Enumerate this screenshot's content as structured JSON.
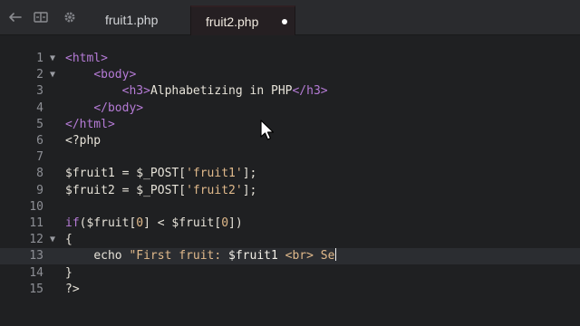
{
  "tabs": [
    {
      "label": "fruit1.php",
      "active": false
    },
    {
      "label": "fruit2.php",
      "active": true,
      "modified": true
    }
  ],
  "toolbar_icons": [
    "back-arrow-icon",
    "split-view-icon",
    "gear-icon"
  ],
  "editor": {
    "current_line": 13,
    "lines": [
      {
        "num": "1",
        "fold": "▼",
        "indent": "",
        "tokens": [
          {
            "t": "<html>",
            "c": "tag"
          }
        ]
      },
      {
        "num": "2",
        "fold": "▼",
        "indent": "    ",
        "tokens": [
          {
            "t": "<body>",
            "c": "tag"
          }
        ]
      },
      {
        "num": "3",
        "fold": "",
        "indent": "        ",
        "tokens": [
          {
            "t": "<h3>",
            "c": "tag"
          },
          {
            "t": "Alphabetizing in PHP",
            "c": "text"
          },
          {
            "t": "</h3>",
            "c": "tag"
          }
        ]
      },
      {
        "num": "4",
        "fold": "",
        "indent": "    ",
        "tokens": [
          {
            "t": "</body>",
            "c": "tag"
          }
        ]
      },
      {
        "num": "5",
        "fold": "",
        "indent": "",
        "tokens": [
          {
            "t": "</html>",
            "c": "tag"
          }
        ]
      },
      {
        "num": "6",
        "fold": "",
        "indent": "",
        "tokens": [
          {
            "t": "<?php",
            "c": "text"
          }
        ]
      },
      {
        "num": "7",
        "fold": "",
        "indent": "",
        "tokens": []
      },
      {
        "num": "8",
        "fold": "",
        "indent": "",
        "tokens": [
          {
            "t": "$fruit1 = $_POST[",
            "c": "text"
          },
          {
            "t": "'fruit1'",
            "c": "str"
          },
          {
            "t": "];",
            "c": "text"
          }
        ]
      },
      {
        "num": "9",
        "fold": "",
        "indent": "",
        "tokens": [
          {
            "t": "$fruit2 = $_POST[",
            "c": "text"
          },
          {
            "t": "'fruit2'",
            "c": "str"
          },
          {
            "t": "];",
            "c": "text"
          }
        ]
      },
      {
        "num": "10",
        "fold": "",
        "indent": "",
        "tokens": []
      },
      {
        "num": "11",
        "fold": "",
        "indent": "",
        "tokens": [
          {
            "t": "if",
            "c": "kw"
          },
          {
            "t": "($fruit[",
            "c": "text"
          },
          {
            "t": "0",
            "c": "str"
          },
          {
            "t": "] < $fruit[",
            "c": "text"
          },
          {
            "t": "0",
            "c": "str"
          },
          {
            "t": "])",
            "c": "text"
          }
        ]
      },
      {
        "num": "12",
        "fold": "▼",
        "indent": "",
        "tokens": [
          {
            "t": "{",
            "c": "text"
          }
        ]
      },
      {
        "num": "13",
        "fold": "",
        "indent": "    ",
        "tokens": [
          {
            "t": "echo ",
            "c": "text"
          },
          {
            "t": "\"First fruit: ",
            "c": "str"
          },
          {
            "t": "$fruit1",
            "c": "var"
          },
          {
            "t": " <br> Se",
            "c": "str"
          }
        ],
        "caret": true
      },
      {
        "num": "14",
        "fold": "",
        "indent": "",
        "tokens": [
          {
            "t": "}",
            "c": "text"
          }
        ]
      },
      {
        "num": "15",
        "fold": "",
        "indent": "",
        "tokens": [
          {
            "t": "?>",
            "c": "text"
          }
        ]
      }
    ]
  }
}
